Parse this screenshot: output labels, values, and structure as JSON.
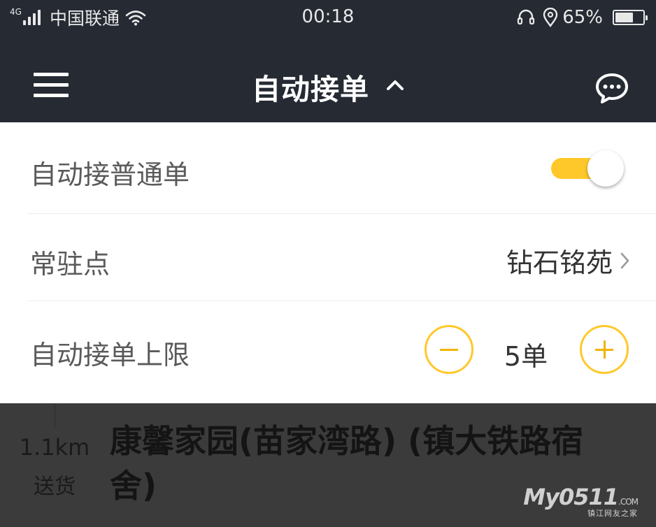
{
  "status_bar": {
    "network": "4G",
    "carrier": "中国联通",
    "time": "00:18",
    "battery_percent": "65%",
    "battery_level": 0.65
  },
  "header": {
    "title": "自动接单",
    "menu_icon": "hamburger-menu-icon",
    "title_caret_icon": "chevron-up-icon",
    "chat_icon": "chat-bubble-icon"
  },
  "settings": {
    "auto_normal_label": "自动接普通单",
    "auto_normal_enabled": true,
    "station_label": "常驻点",
    "station_value": "钻石铭苑",
    "limit_label": "自动接单上限",
    "limit_value": "5单"
  },
  "order": {
    "distance": "1.1km",
    "type": "送货",
    "address": "康馨家园(苗家湾路) (镇大铁路宿舍)"
  },
  "watermark": {
    "logo_text": "My0511",
    "domain": ".COM",
    "subtitle": "镇江网友之家"
  },
  "colors": {
    "header_bg": "#252a33",
    "accent": "#ffc82a",
    "overlay_bg": "#3b3b3b"
  }
}
